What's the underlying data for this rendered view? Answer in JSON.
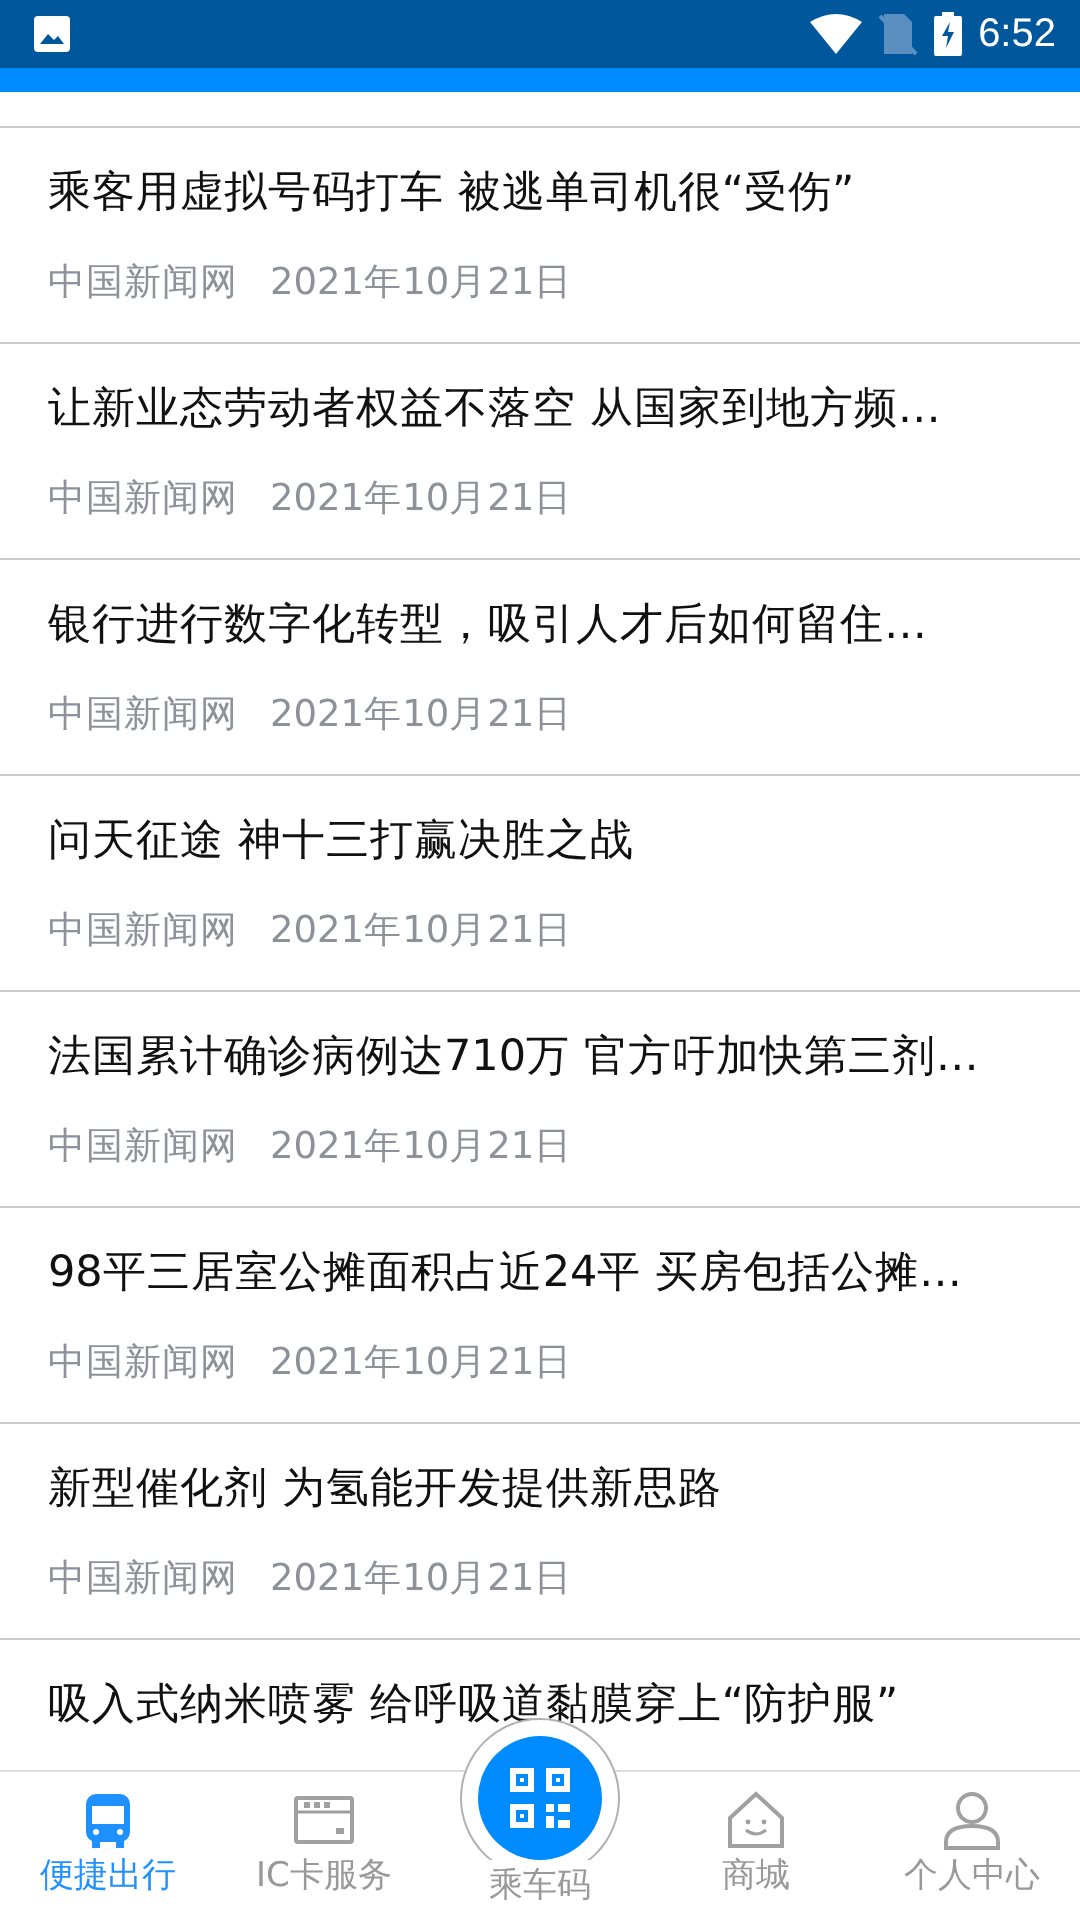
{
  "status_bar": {
    "time": "6:52"
  },
  "news": [
    {
      "title": "乘客用虚拟号码打车 被逃单司机很“受伤”",
      "source": "中国新闻网",
      "date": "2021年10月21日"
    },
    {
      "title": "让新业态劳动者权益不落空 从国家到地方频…",
      "source": "中国新闻网",
      "date": "2021年10月21日"
    },
    {
      "title": "银行进行数字化转型，吸引人才后如何留住…",
      "source": "中国新闻网",
      "date": "2021年10月21日"
    },
    {
      "title": "问天征途 神十三打赢决胜之战",
      "source": "中国新闻网",
      "date": "2021年10月21日"
    },
    {
      "title": "法国累计确诊病例达710万 官方吁加快第三剂…",
      "source": "中国新闻网",
      "date": "2021年10月21日"
    },
    {
      "title": "98平三居室公摊面积占近24平 买房包括公摊…",
      "source": "中国新闻网",
      "date": "2021年10月21日"
    },
    {
      "title": "新型催化剂 为氢能开发提供新思路",
      "source": "中国新闻网",
      "date": "2021年10月21日"
    },
    {
      "title": "吸入式纳米喷雾 给呼吸道黏膜穿上“防护服”"
    }
  ],
  "bottom_nav": [
    {
      "label": "便捷出行",
      "kind": "tab",
      "selected": true
    },
    {
      "label": "IC卡服务",
      "kind": "tab",
      "selected": false
    },
    {
      "label": "乘车码",
      "kind": "center",
      "selected": false
    },
    {
      "label": "商城",
      "kind": "tab",
      "selected": false
    },
    {
      "label": "个人中心",
      "kind": "tab",
      "selected": false
    }
  ]
}
